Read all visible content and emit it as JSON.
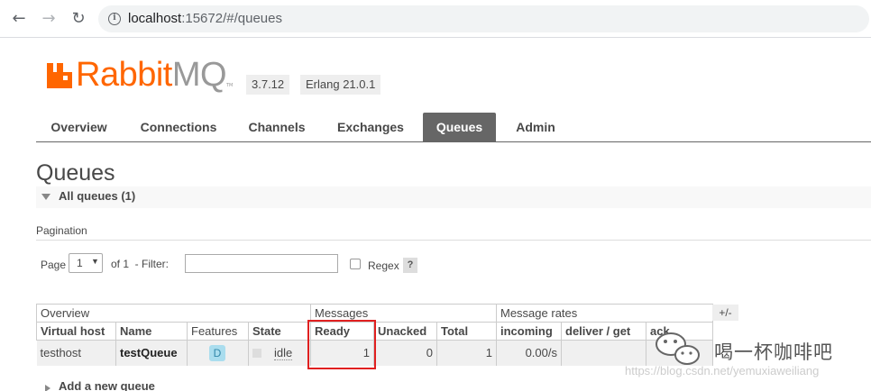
{
  "browser": {
    "url_host": "localhost",
    "url_rest": ":15672/#/queues"
  },
  "header": {
    "brand_rabbit": "Rabbit",
    "brand_mq": "MQ",
    "brand_tm": "TM",
    "version": "3.7.12",
    "erlang": "Erlang 21.0.1",
    "colors": {
      "brand": "#ff6600",
      "tab_active_bg": "#666666",
      "highlight": "#e02020"
    }
  },
  "tabs": [
    {
      "label": "Overview",
      "active": false
    },
    {
      "label": "Connections",
      "active": false
    },
    {
      "label": "Channels",
      "active": false
    },
    {
      "label": "Exchanges",
      "active": false
    },
    {
      "label": "Queues",
      "active": true
    },
    {
      "label": "Admin",
      "active": false
    }
  ],
  "page": {
    "title": "Queues",
    "section_label": "All queues (1)",
    "pagination_label": "Pagination",
    "page_label": "Page",
    "page_value": "1",
    "of_label": "of 1  - Filter:",
    "filter_value": "",
    "regex_label": "Regex",
    "help_label": "?",
    "plus_minus": "+/-",
    "add_queue": "Add a new queue"
  },
  "table": {
    "groups": [
      "Overview",
      "Messages",
      "Message rates"
    ],
    "columns": [
      "Virtual host",
      "Name",
      "Features",
      "State",
      "Ready",
      "Unacked",
      "Total",
      "incoming",
      "deliver / get",
      "ack"
    ],
    "rows": [
      {
        "vhost": "testhost",
        "name": "testQueue",
        "feature": "D",
        "state": "idle",
        "ready": "1",
        "unacked": "0",
        "total": "1",
        "incoming": "0.00/s",
        "deliver_get": "",
        "ack": ""
      }
    ]
  },
  "watermark": {
    "text": "喝一杯咖啡吧",
    "url": "https://blog.csdn.net/yemuxiaweiliang"
  }
}
